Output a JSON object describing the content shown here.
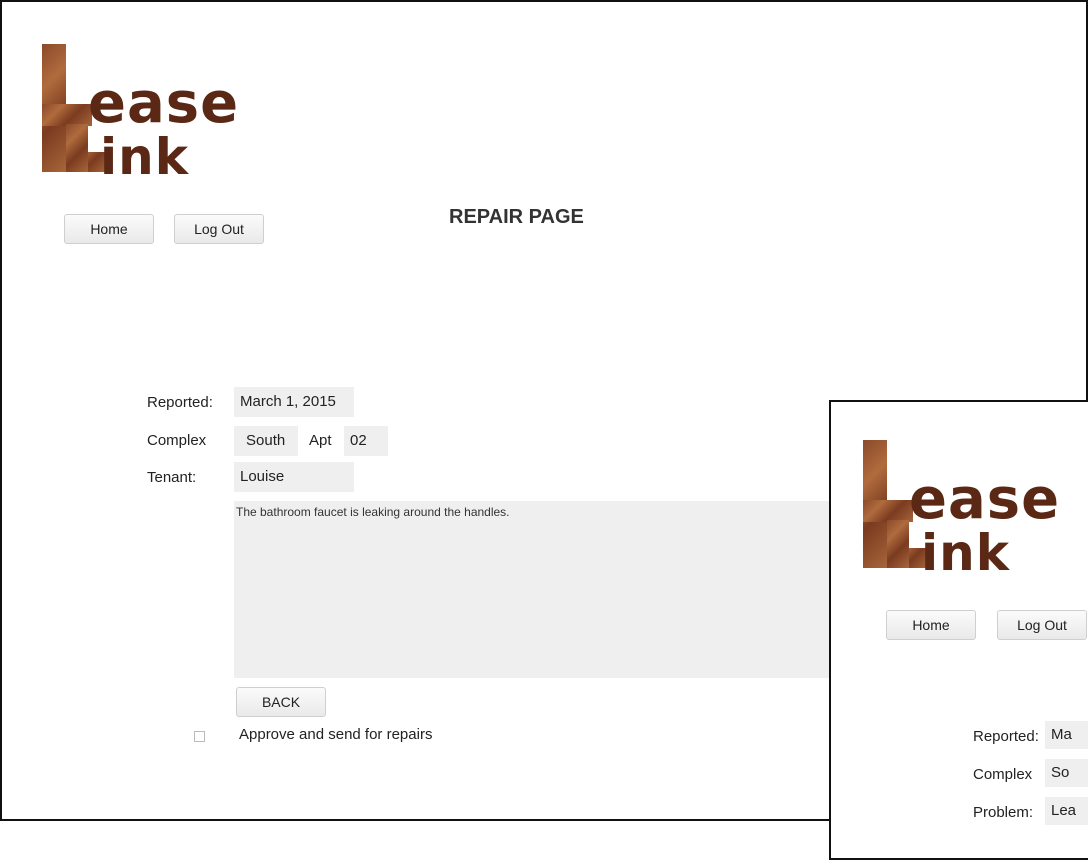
{
  "logo": {
    "line1": "ease",
    "line2": "ink"
  },
  "nav": {
    "home_label": "Home",
    "logout_label": "Log Out"
  },
  "page_title": "REPAIR PAGE",
  "form": {
    "reported_label": "Reported:",
    "reported_value": "March 1, 2015",
    "complex_label": "Complex",
    "complex_value": "South",
    "apt_label": "Apt",
    "apt_value": "02",
    "tenant_label": "Tenant:",
    "tenant_value": "Louise",
    "description": "The bathroom faucet is leaking around the handles.",
    "back_label": "BACK",
    "approve_label": "Approve and send for repairs"
  },
  "second": {
    "home_label": "Home",
    "logout_label": "Log Out",
    "reported_label": "Reported:",
    "reported_value": "Ma",
    "complex_label": "Complex",
    "complex_value": "So",
    "problem_label": "Problem:",
    "problem_value": "Lea"
  },
  "colors": {
    "logo_brown": "#5a2814",
    "field_bg": "#efefef"
  }
}
